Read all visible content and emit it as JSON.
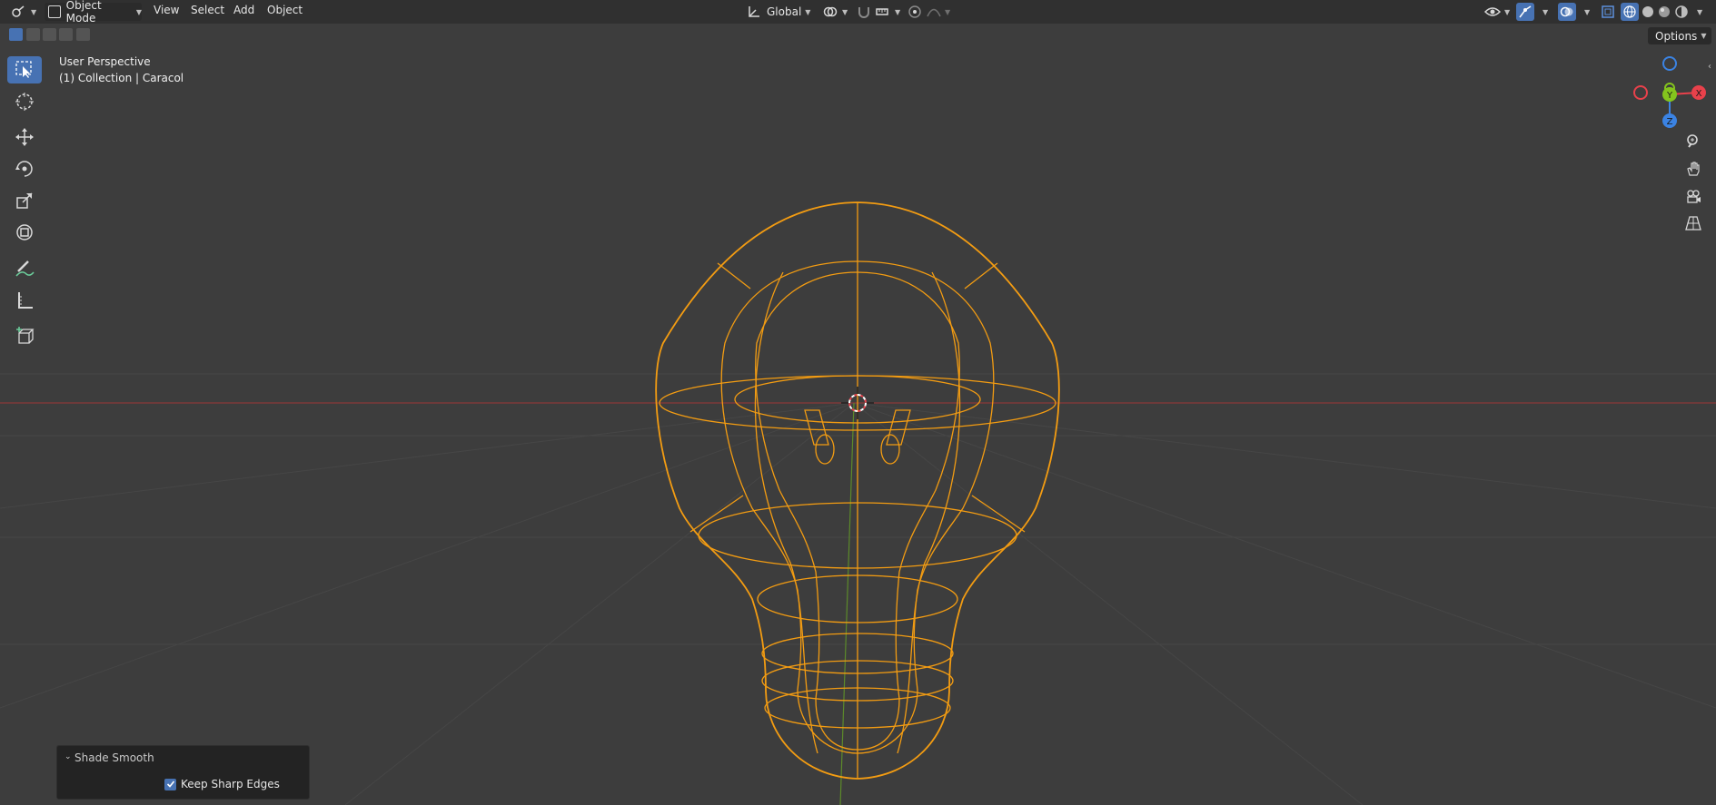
{
  "header": {
    "mode_label": "Object Mode",
    "menus": [
      "View",
      "Select",
      "Add",
      "Object"
    ],
    "orientation_label": "Global",
    "options_label": "Options"
  },
  "viewport": {
    "view_name": "User Perspective",
    "collection_info": "(1) Collection | Caracol"
  },
  "gizmo": {
    "axes": [
      "X",
      "Y",
      "Z"
    ],
    "colors": {
      "x": "#e8414b",
      "y": "#84c41d",
      "z": "#3b83e3",
      "selected": "#f39c12"
    }
  },
  "redo_panel": {
    "title": "Shade Smooth",
    "keep_sharp_edges_label": "Keep Sharp Edges",
    "keep_sharp_edges": true
  },
  "tools": [
    "select-box",
    "cursor",
    "move",
    "rotate",
    "scale",
    "transform",
    "annotate",
    "measure",
    "add-cube"
  ],
  "theme": {
    "accent": "#4772b3",
    "wire_selected": "#f39c12",
    "bg": "#3d3d3d"
  }
}
